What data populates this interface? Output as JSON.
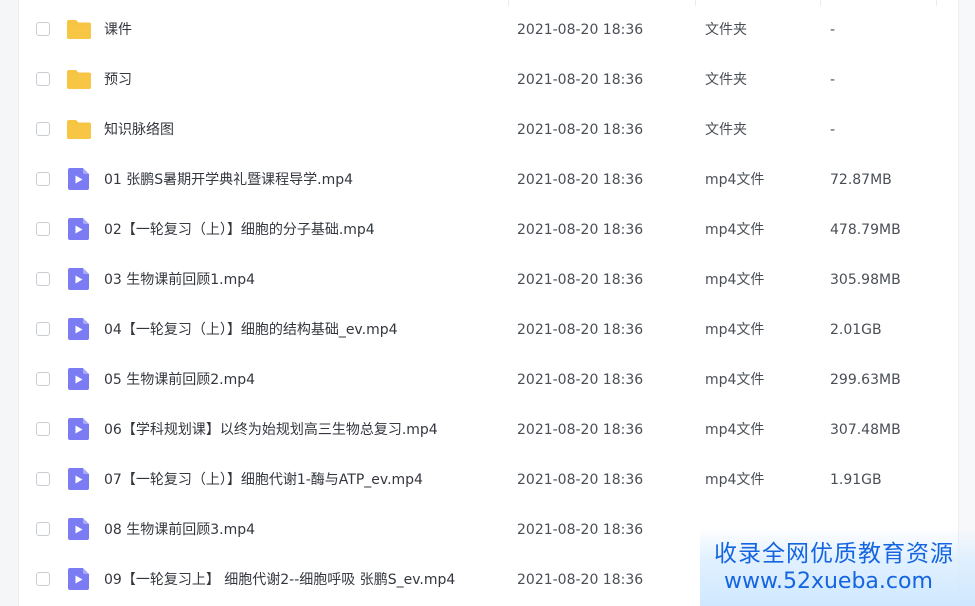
{
  "files": [
    {
      "name": "课件",
      "date": "2021-08-20 18:36",
      "type": "文件夹",
      "size": "-",
      "icon": "folder-icon"
    },
    {
      "name": "预习",
      "date": "2021-08-20 18:36",
      "type": "文件夹",
      "size": "-",
      "icon": "folder-icon"
    },
    {
      "name": "知识脉络图",
      "date": "2021-08-20 18:36",
      "type": "文件夹",
      "size": "-",
      "icon": "folder-icon"
    },
    {
      "name": "01 张鹏S暑期开学典礼暨课程导学.mp4",
      "date": "2021-08-20 18:36",
      "type": "mp4文件",
      "size": "72.87MB",
      "icon": "video-file-icon"
    },
    {
      "name": "02【一轮复习（上）】细胞的分子基础.mp4",
      "date": "2021-08-20 18:36",
      "type": "mp4文件",
      "size": "478.79MB",
      "icon": "video-file-icon"
    },
    {
      "name": "03 生物课前回顾1.mp4",
      "date": "2021-08-20 18:36",
      "type": "mp4文件",
      "size": "305.98MB",
      "icon": "video-file-icon"
    },
    {
      "name": "04【一轮复习（上）】细胞的结构基础_ev.mp4",
      "date": "2021-08-20 18:36",
      "type": "mp4文件",
      "size": "2.01GB",
      "icon": "video-file-icon"
    },
    {
      "name": "05 生物课前回顾2.mp4",
      "date": "2021-08-20 18:36",
      "type": "mp4文件",
      "size": "299.63MB",
      "icon": "video-file-icon"
    },
    {
      "name": "06【学科规划课】以终为始规划高三生物总复习.mp4",
      "date": "2021-08-20 18:36",
      "type": "mp4文件",
      "size": "307.48MB",
      "icon": "video-file-icon"
    },
    {
      "name": "07【一轮复习（上）】细胞代谢1-酶与ATP_ev.mp4",
      "date": "2021-08-20 18:36",
      "type": "mp4文件",
      "size": "1.91GB",
      "icon": "video-file-icon"
    },
    {
      "name": "08 生物课前回顾3.mp4",
      "date": "2021-08-20 18:36",
      "type": "",
      "size": "",
      "icon": "video-file-icon"
    },
    {
      "name": "09【一轮复习上】 细胞代谢2--细胞呼吸  张鹏S_ev.mp4",
      "date": "2021-08-20 18:36",
      "type": "",
      "size": "",
      "icon": "video-file-icon"
    }
  ],
  "watermark": {
    "line1": "收录全网优质教育资源",
    "line2": "www.52xueba.com"
  },
  "colors": {
    "folder": "#f7c544",
    "video": "#7b7cf3",
    "watermark_text": "#1565e0"
  }
}
